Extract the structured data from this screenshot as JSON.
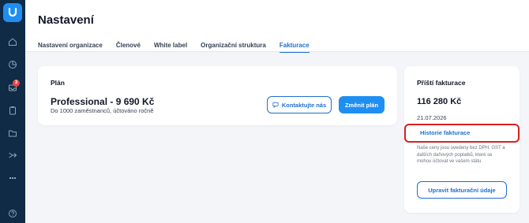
{
  "header": {
    "title": "Nastavení",
    "tabs": [
      {
        "label": "Nastavení organizace"
      },
      {
        "label": "Členové"
      },
      {
        "label": "White label"
      },
      {
        "label": "Organizační struktura"
      },
      {
        "label": "Fakturace"
      }
    ],
    "active_tab": "Fakturace"
  },
  "sidebar": {
    "notification_badge": "3",
    "icons": [
      "home-icon",
      "pie-chart-icon",
      "inbox-icon",
      "clipboard-icon",
      "folder-icon",
      "share-icon",
      "more-icon",
      "help-icon"
    ]
  },
  "plan": {
    "label": "Plán",
    "name": "Professional - 9 690 Kč",
    "description": "Do 1000 zaměstnanců, účtováno ročně",
    "contact_button": "Kontaktujte nás",
    "change_button": "Změnit plán"
  },
  "next_billing": {
    "title": "Příští fakturace",
    "amount": "116 280 Kč",
    "date": "21.07.2026",
    "history_link": "Historie fakturace",
    "note": "Naše ceny jsou uvedeny bez DPH, GST a dalších daňových poplatků, které se mohou účtovat ve vašem státu",
    "edit_button": "Upravit fakturační údaje"
  },
  "colors": {
    "sidebar": "#0f2b46",
    "accent": "#1f8ef1",
    "link": "#1f6fd1",
    "highlight": "#d92020"
  }
}
